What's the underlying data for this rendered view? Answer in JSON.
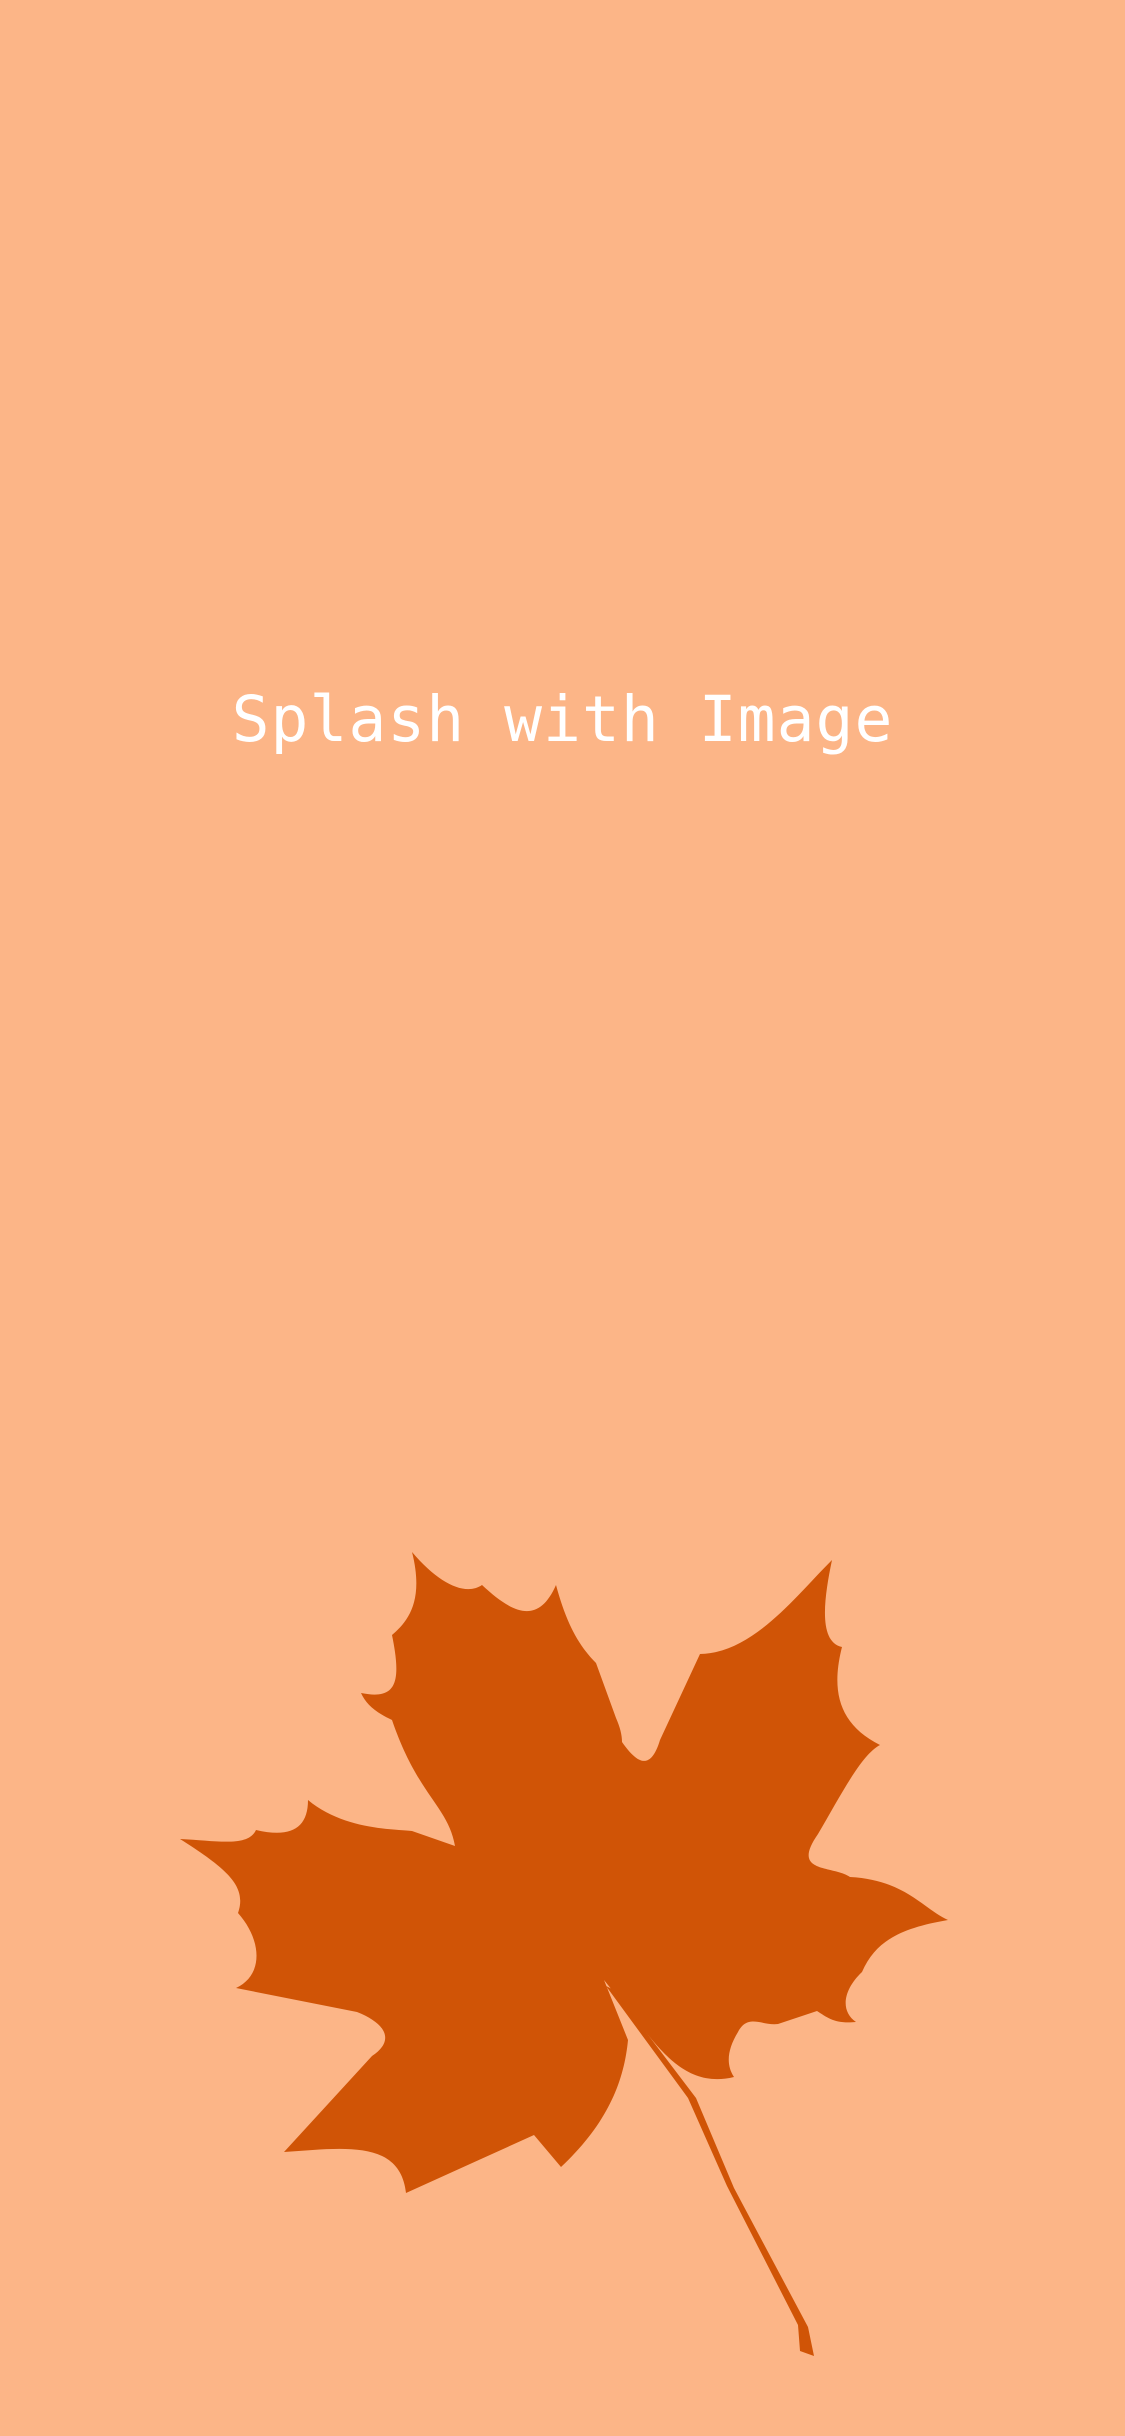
{
  "screen": {
    "title": "Splash with Image",
    "background_color": "#FCB587",
    "title_color": "#FFFFFF",
    "image": {
      "icon": "maple-leaf",
      "color": "#D05406"
    }
  }
}
